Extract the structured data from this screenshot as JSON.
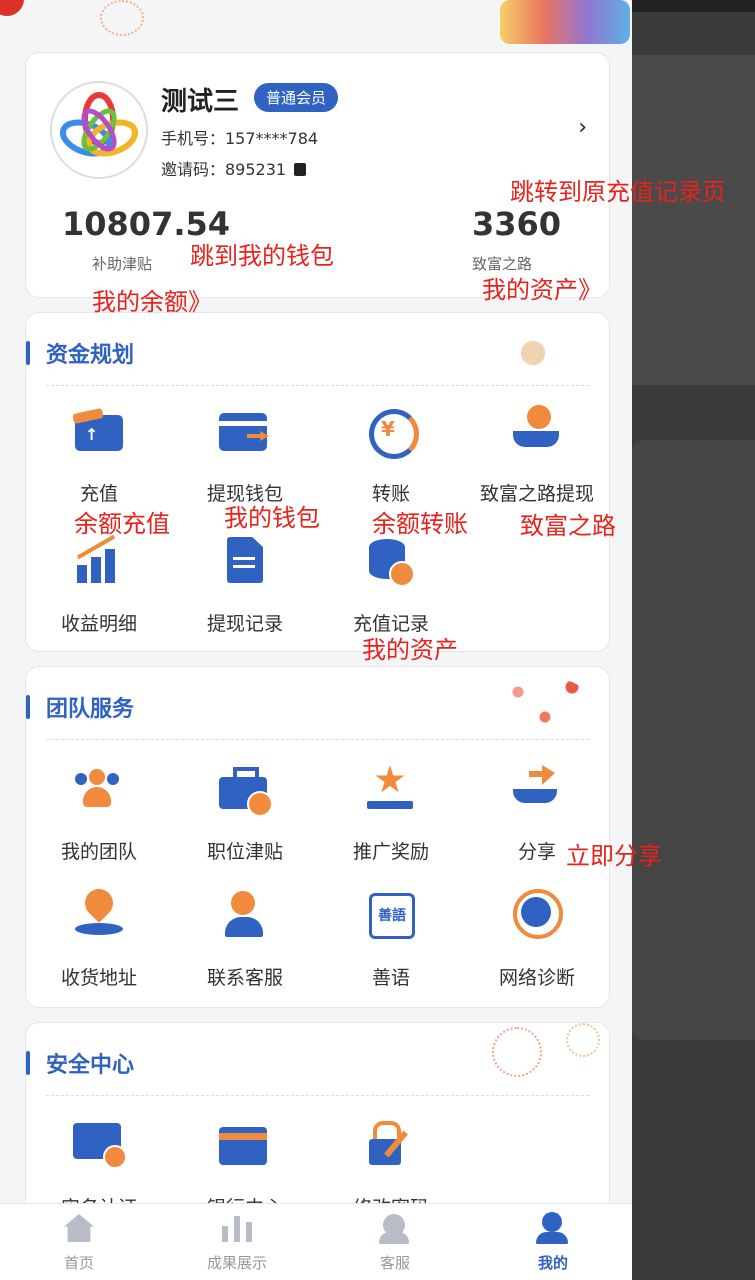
{
  "profile": {
    "name": "测试三",
    "badge": "普通会员",
    "phone": "手机号：157****784",
    "invite": "邀请码：895231",
    "balance_value": "10807.54",
    "balance_label": "补助津贴",
    "asset_value": "3360",
    "asset_label": "致富之路"
  },
  "sections": [
    {
      "title": "资金规划",
      "items": [
        {
          "label": "充值",
          "icon": "wallet-recharge-icon"
        },
        {
          "label": "提现钱包",
          "icon": "card-withdraw-icon"
        },
        {
          "label": "转账",
          "icon": "yen-transfer-icon"
        },
        {
          "label": "致富之路提现",
          "icon": "hand-coin-icon"
        },
        {
          "label": "收益明细",
          "icon": "chart-growth-icon"
        },
        {
          "label": "提现记录",
          "icon": "document-icon"
        },
        {
          "label": "充值记录",
          "icon": "database-clock-icon"
        }
      ]
    },
    {
      "title": "团队服务",
      "items": [
        {
          "label": "我的团队",
          "icon": "team-icon"
        },
        {
          "label": "职位津贴",
          "icon": "briefcase-icon"
        },
        {
          "label": "推广奖励",
          "icon": "star-podium-icon"
        },
        {
          "label": "分享",
          "icon": "share-hand-icon"
        },
        {
          "label": "收货地址",
          "icon": "location-pin-icon"
        },
        {
          "label": "联系客服",
          "icon": "customer-service-icon"
        },
        {
          "label": "善语",
          "icon": "shanyu-icon"
        },
        {
          "label": "网络诊断",
          "icon": "globe-icon"
        }
      ]
    },
    {
      "title": "安全中心",
      "items": [
        {
          "label": "实名认证",
          "icon": "id-card-icon"
        },
        {
          "label": "银行中心",
          "icon": "bank-card-icon"
        },
        {
          "label": "修改密码",
          "icon": "lock-edit-icon"
        }
      ]
    }
  ],
  "annotations": {
    "a1": "跳转到原充值记录页",
    "a2": "跳到我的钱包",
    "a3": "我的余额》",
    "a4": "我的资产》",
    "a5": "余额充值",
    "a6": "我的钱包",
    "a7": "余额转账",
    "a8": "致富之路",
    "a9": "我的资产",
    "a10": "立即分享"
  },
  "icon_glyphs": {
    "yen": "¥",
    "shanyu": "善語"
  },
  "tabs": [
    {
      "label": "首页",
      "icon": "home-icon"
    },
    {
      "label": "成果展示",
      "icon": "bar-chart-icon"
    },
    {
      "label": "客服",
      "icon": "headset-icon"
    },
    {
      "label": "我的",
      "icon": "user-icon",
      "active": true
    }
  ],
  "colors": {
    "primary": "#2f62c1",
    "accent_orange": "#f08a3c",
    "annotation": "#e8221c"
  }
}
